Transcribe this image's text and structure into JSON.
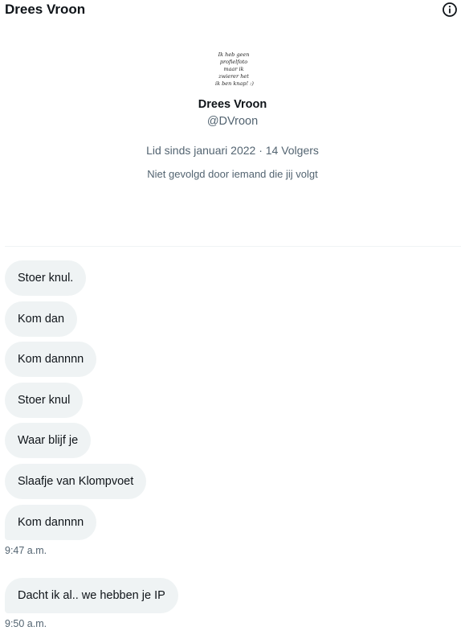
{
  "header": {
    "title": "Drees Vroon",
    "info_icon": "info-circle-icon"
  },
  "profile": {
    "avatar_text": [
      "Ik heb geen",
      "profielfoto",
      "maar ik",
      "zwierer het",
      "ik ben knap! :)"
    ],
    "name": "Drees Vroon",
    "handle": "@DVroon",
    "meta": "Lid sinds januari 2022 · 14 Volgers",
    "followed_by": "Niet gevolgd door iemand die jij volgt"
  },
  "messages": [
    {
      "text": "Stoer knul."
    },
    {
      "text": "Kom dan"
    },
    {
      "text": "Kom dannnn"
    },
    {
      "text": "Stoer knul"
    },
    {
      "text": "Waar blijf je"
    },
    {
      "text": "Slaafje van Klompvoet"
    },
    {
      "text": "Kom dannnn"
    },
    {
      "text": "Dacht ik al.. we hebben je IP"
    }
  ],
  "timestamps": [
    "9:47 a.m.",
    "9:50 a.m."
  ]
}
